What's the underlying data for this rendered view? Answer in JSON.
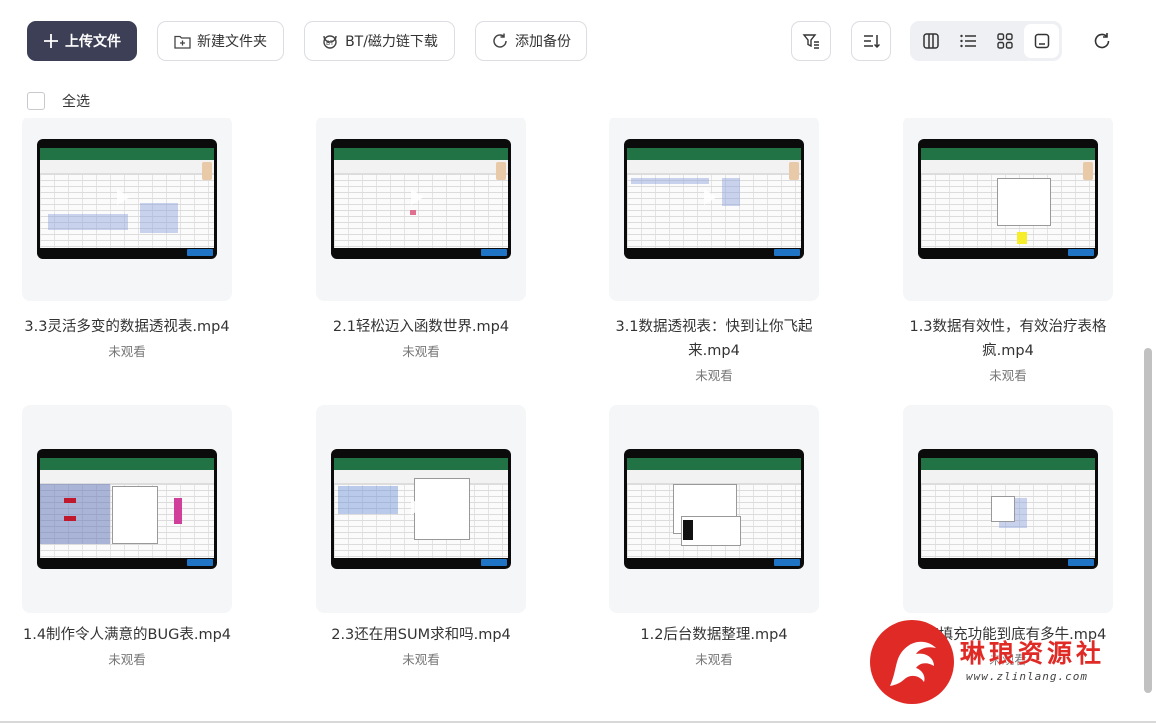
{
  "toolbar": {
    "upload_label": "上传文件",
    "new_folder_label": "新建文件夹",
    "bt_download_label": "BT/磁力链下载",
    "add_backup_label": "添加备份",
    "icons": [
      "plus-icon",
      "folder-plus-icon",
      "magnet-icon",
      "sync-icon",
      "filter-icon",
      "sort-icon",
      "columns-view-icon",
      "list-view-icon",
      "grid-view-icon",
      "preview-view-icon",
      "refresh-icon"
    ],
    "active_view": "preview-view"
  },
  "select_all_label": "全选",
  "files": [
    {
      "name": "3.3灵活多变的数据透视表.mp4",
      "status": "未观看"
    },
    {
      "name": "2.1轻松迈入函数世界.mp4",
      "status": "未观看"
    },
    {
      "name": "3.1数据透视表：快到让你飞起来.mp4",
      "status": "未观看"
    },
    {
      "name": "1.3数据有效性，有效治疗表格疯.mp4",
      "status": "未观看"
    },
    {
      "name": "1.4制作令人满意的BUG表.mp4",
      "status": "未观看"
    },
    {
      "name": "2.3还在用SUM求和吗.mp4",
      "status": "未观看"
    },
    {
      "name": "1.2后台数据整理.mp4",
      "status": "未观看"
    },
    {
      "name": "快速填充功能到底有多牛.mp4",
      "status": "未观看"
    }
  ],
  "watermark": {
    "text": "琳琅资源社",
    "sub": "www.zlinlang.com"
  },
  "colors": {
    "primary_button": "#3c3f55",
    "excel_green": "#217346",
    "watermark_red": "#e02a26"
  }
}
